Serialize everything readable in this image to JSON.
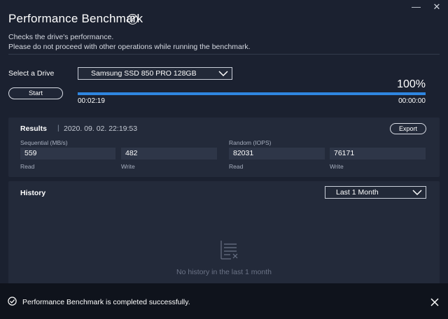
{
  "window": {
    "title": "Performance Benchmark",
    "help_icon_glyph": "?",
    "controls": [
      {
        "name": "minimize-icon",
        "glyph": "—"
      },
      {
        "name": "close-icon",
        "glyph": "✕"
      }
    ]
  },
  "description": {
    "line1": "Checks the drive's performance.",
    "line2": "Please do not proceed with other operations while running the benchmark."
  },
  "drive": {
    "label": "Select a Drive",
    "selected": "Samsung SSD 850 PRO 128GB"
  },
  "start_button": "Start",
  "progress": {
    "percent_text": "100%",
    "fraction": 1.0,
    "elapsed": "00:02:19",
    "remaining": "00:00:00"
  },
  "results": {
    "title": "Results",
    "separator": "|",
    "date": "2020. 09. 02. 22:19:53",
    "export_label": "Export",
    "sequential": {
      "label": "Sequential (MB/s)",
      "read": "559",
      "write": "482"
    },
    "random": {
      "label": "Random (IOPS)",
      "read": "82031",
      "write": "76171"
    },
    "read_label": "Read",
    "write_label": "Write"
  },
  "history": {
    "title": "History",
    "period_selected": "Last 1 Month",
    "empty_text": "No history in the last 1 month"
  },
  "toast": {
    "message": "Performance Benchmark is completed successfully."
  },
  "colors": {
    "background": "#1b2130",
    "panel": "#232a3a",
    "accent": "#2f86e0",
    "toast_bg": "#0f131c"
  }
}
